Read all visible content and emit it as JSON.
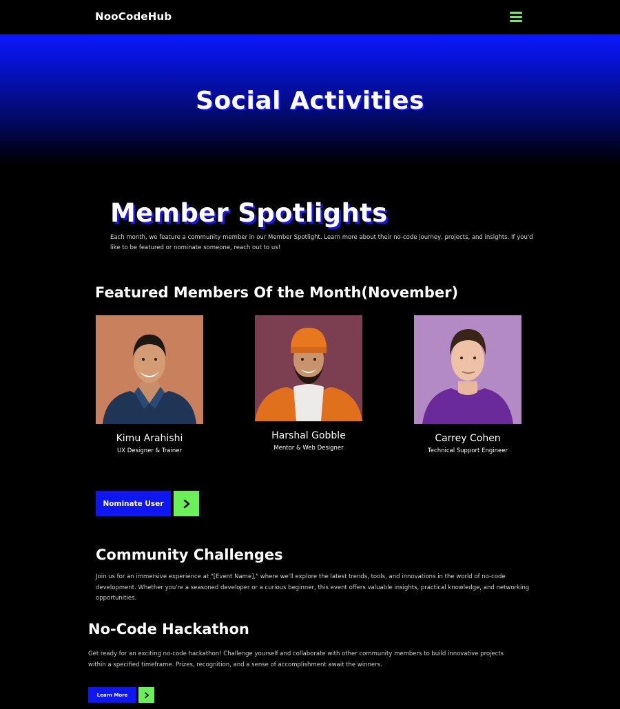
{
  "navbar": {
    "brand": "NooCodeHub",
    "menu_icon": "hamburger-menu-icon"
  },
  "hero": {
    "title": "Social Activities"
  },
  "spotlights": {
    "title": "Member Spotlights",
    "description": "Each month, we feature a community member in our Member Spotlight. Learn more about their no-code journey, projects, and insights. If you'd like to be featured or nominate someone, reach out to us!"
  },
  "featured": {
    "title": "Featured Members Of the Month(November)",
    "members": [
      {
        "name": "Kimu Arahishi",
        "role": "UX Designer & Trainer",
        "bg": "#c9805c"
      },
      {
        "name": "Harshal Gobble",
        "role": "Mentor & Web Designer",
        "bg": "#7c3f52"
      },
      {
        "name": "Carrey Cohen",
        "role": "Technical Support Engineer",
        "bg": "#b48ac4"
      }
    ]
  },
  "nominate": {
    "label": "Nominate User",
    "arrow_icon": "chevron-right-icon"
  },
  "challenges": {
    "title": "Community Challenges",
    "description": "Join us for an immersive experience at \"[Event Name],\" where we'll explore the latest trends, tools, and innovations in the world of no-code development. Whether you're a seasoned developer or a curious beginner, this event offers valuable insights, practical knowledge, and networking opportunities."
  },
  "hackathon": {
    "title": "No-Code Hackathon",
    "description": "Get ready for an exciting no-code hackathon! Challenge yourself and collaborate with other community members to build innovative projects within a specified timeframe. Prizes, recognition, and a sense of accomplishment await the winners.",
    "button_label": "Learn More"
  },
  "colors": {
    "accent_blue": "#0f17f0",
    "accent_green": "#6cf05a",
    "background": "#000000"
  }
}
